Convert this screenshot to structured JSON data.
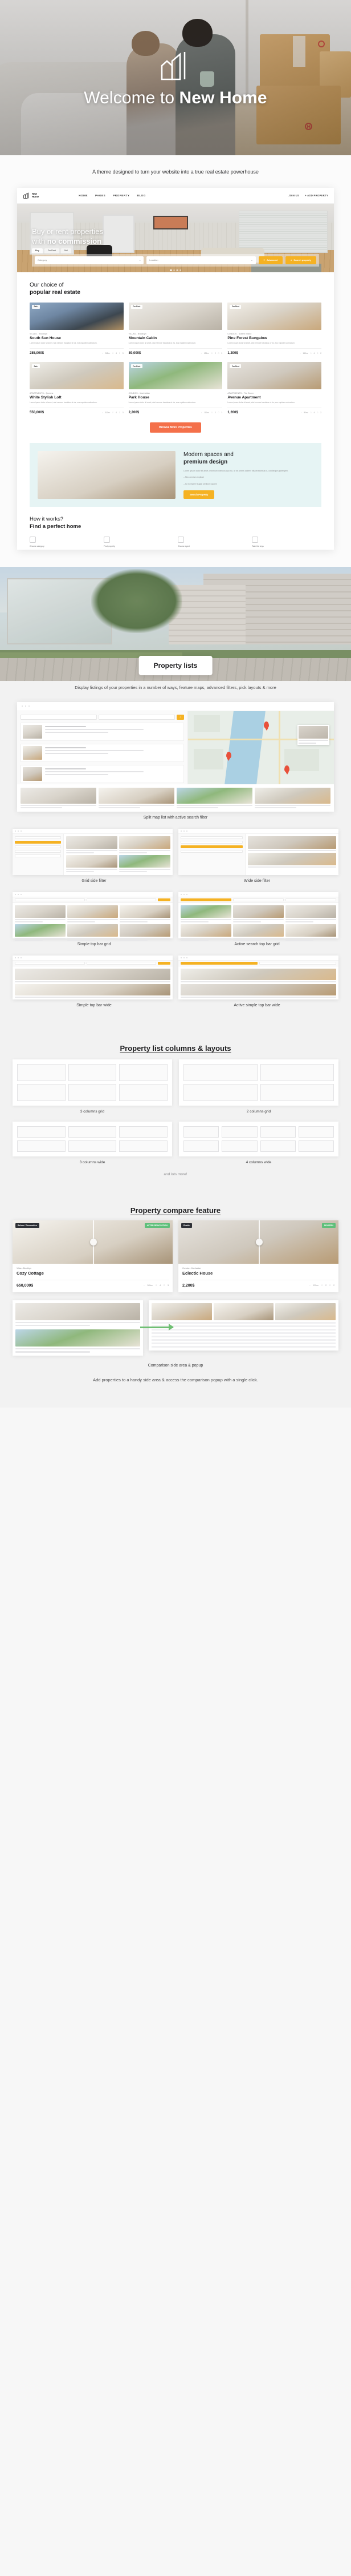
{
  "hero": {
    "title_light": "Welcome to ",
    "title_bold": "New Home",
    "logo_icon": "house-outline-icon"
  },
  "tagline": "A theme designed to turn your website into a true real estate powerhouse",
  "homepage_mock": {
    "brand_line1": "New",
    "brand_line2": "Home",
    "nav": [
      "HOME",
      "PAGES",
      "PROPERTY",
      "BLOG"
    ],
    "nav_right": [
      "JOIN US",
      "+ ADD PROPERTY"
    ],
    "hero_line1": "Buy or rent properties",
    "hero_line2_light": "with ",
    "hero_line2_bold": "no commission",
    "tabs": [
      "Buy",
      "For Rent",
      "Sell"
    ],
    "field_category": "Category",
    "field_location": "Location",
    "btn_advanced": "Advanced",
    "btn_search": "Search property",
    "section_h_thin": "Our choice of",
    "section_h_bold": "popular real estate",
    "browse_btn": "Browse More Properties",
    "properties": [
      {
        "badge": "Sale",
        "location": "VILLAS - Brooklyn",
        "name": "South Sun House",
        "desc": "Lorem ipsum dolor sit amet, wisi nemore tractatos ut vis, eos equidem admodum.",
        "price": "285,000$",
        "area": "265m²",
        "beds": "4",
        "baths": "3"
      },
      {
        "badge": "For Rent",
        "location": "VILLAS - Brooklyn",
        "name": "Mountain Cabin",
        "desc": "Lorem ipsum dolor sit amet, wisi nemore tractatos ut vis, eos equidem admodum.",
        "price": "89,000$",
        "area": "125m²",
        "beds": "2",
        "baths": "2"
      },
      {
        "badge": "For Rent",
        "location": "CONDOS - Staten Island",
        "name": "Pine Forest Bungalow",
        "desc": "Lorem ipsum dolor sit amet, wisi nemore tractatos ut vis, eos equidem admodum.",
        "price": "1,200$",
        "area": "165m²",
        "beds": "4",
        "baths": "2"
      },
      {
        "badge": "Sale",
        "location": "APARTMENTS - Queens",
        "name": "White Stylish Loft",
        "desc": "Lorem ipsum dolor sit amet, wisi nemore tractatos ut vis, eos equidem admodum.",
        "price": "550,000$",
        "area": "310m²",
        "beds": "4",
        "baths": "3"
      },
      {
        "badge": "For Rent",
        "location": "CONDOS - Manhattan",
        "name": "Park House",
        "desc": "Lorem ipsum dolor sit amet, wisi nemore tractatos ut vis, eos equidem admodum.",
        "price": "2,200$",
        "area": "110m²",
        "beds": "2",
        "baths": "2"
      },
      {
        "badge": "For Rent",
        "location": "APARTMENTS - The Bronx",
        "name": "Avenue Apartment",
        "desc": "Lorem ipsum dolor sit amet, wisi nemore tractatos ut vis, eos equidem admodum.",
        "price": "1,200$",
        "area": "80m²",
        "beds": "4",
        "baths": "2"
      }
    ],
    "promo": {
      "h_thin": "Modern spaces and",
      "h_bold": "premium design",
      "paragraph": "Lorem ipsum dolor sit amet, minimum inimicus quo no, at vis primis viderer vituperatoribus in, cotidieque gubergren.",
      "bullets": [
        "Meo omnium explicari",
        "Ad no legere feugiat per illum loquem"
      ],
      "button": "Search Property"
    },
    "how": {
      "h_thin": "How it works?",
      "h_bold": "Find a perfect home",
      "steps": [
        "Choose category",
        "Find property",
        "Choose agent",
        "Take the keys"
      ]
    }
  },
  "property_lists": {
    "hero_chip": "Property lists",
    "intro": "Display listings of your properties in a number of ways, feature maps, advanced filters, pick layouts & more",
    "split_caption": "Split map list with active search filter",
    "captions": [
      "Grid side filter",
      "Wide side filter",
      "Simple top bar grid",
      "Active search top bar grid",
      "Simple top bar wide",
      "Active simple top bar wide"
    ]
  },
  "columns_section": {
    "title": "Property list columns & layouts",
    "captions": [
      "3 columns grid",
      "2 columns grid",
      "3 columns wide",
      "4 columns wide"
    ],
    "and_more": "and lots more!"
  },
  "compare_section": {
    "title": "Property compare feature",
    "cards": [
      {
        "tag_left": "Before / Renovation",
        "tag_right": "AFTER RENOVATION",
        "location": "Villas - Brooklyn",
        "name": "Cozy Cottage",
        "price": "650,000$",
        "area": "265m²",
        "beds": "4",
        "baths": "3"
      },
      {
        "tag_left": "Rustic",
        "tag_right": "MODERN",
        "location": "Condos - Manhattan",
        "name": "Eclectic House",
        "price": "2,200$",
        "area": "125m²",
        "beds": "2",
        "baths": "2"
      }
    ],
    "bottom_caption_line1": "Comparison side area & popup",
    "bottom_caption_line2": "Add properties to a handy side area & access the comparison popup with a single click."
  },
  "colors": {
    "accent_orange": "#f4704a",
    "accent_yellow": "#f5b223",
    "accent_green": "#6fbf73",
    "promo_bg": "#e6f4f4"
  }
}
